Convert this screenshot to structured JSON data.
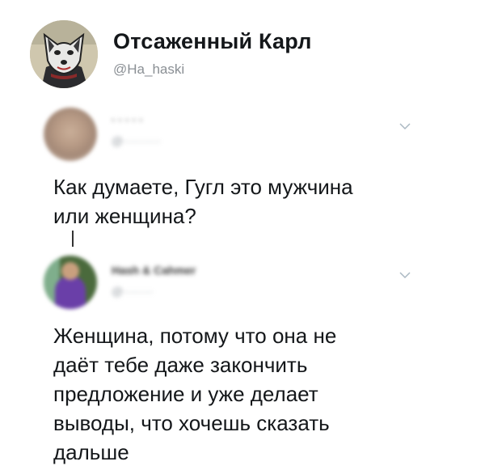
{
  "header": {
    "name": "Отсаженный Карл",
    "handle": "@Ha_haski",
    "avatar_icon": "cartoon-wolf-avatar"
  },
  "tweets": [
    {
      "name": "· · · · ·",
      "handle": "@··········",
      "text_lines": [
        "Как думаете, Гугл это мужчина",
        "или женщина?"
      ],
      "menu_icon": "chevron-down-icon"
    },
    {
      "name": "Hash & Cahmer",
      "handle": "@········",
      "text_lines": [
        "Женщина, потому что она не",
        "даёт тебе даже закончить",
        "предложение и уже делает",
        "выводы, что хочешь сказать",
        "дальше"
      ],
      "menu_icon": "chevron-down-icon"
    }
  ],
  "colors": {
    "text": "#14171a",
    "handle": "#8a8f94",
    "chevron": "#aab8c2"
  }
}
